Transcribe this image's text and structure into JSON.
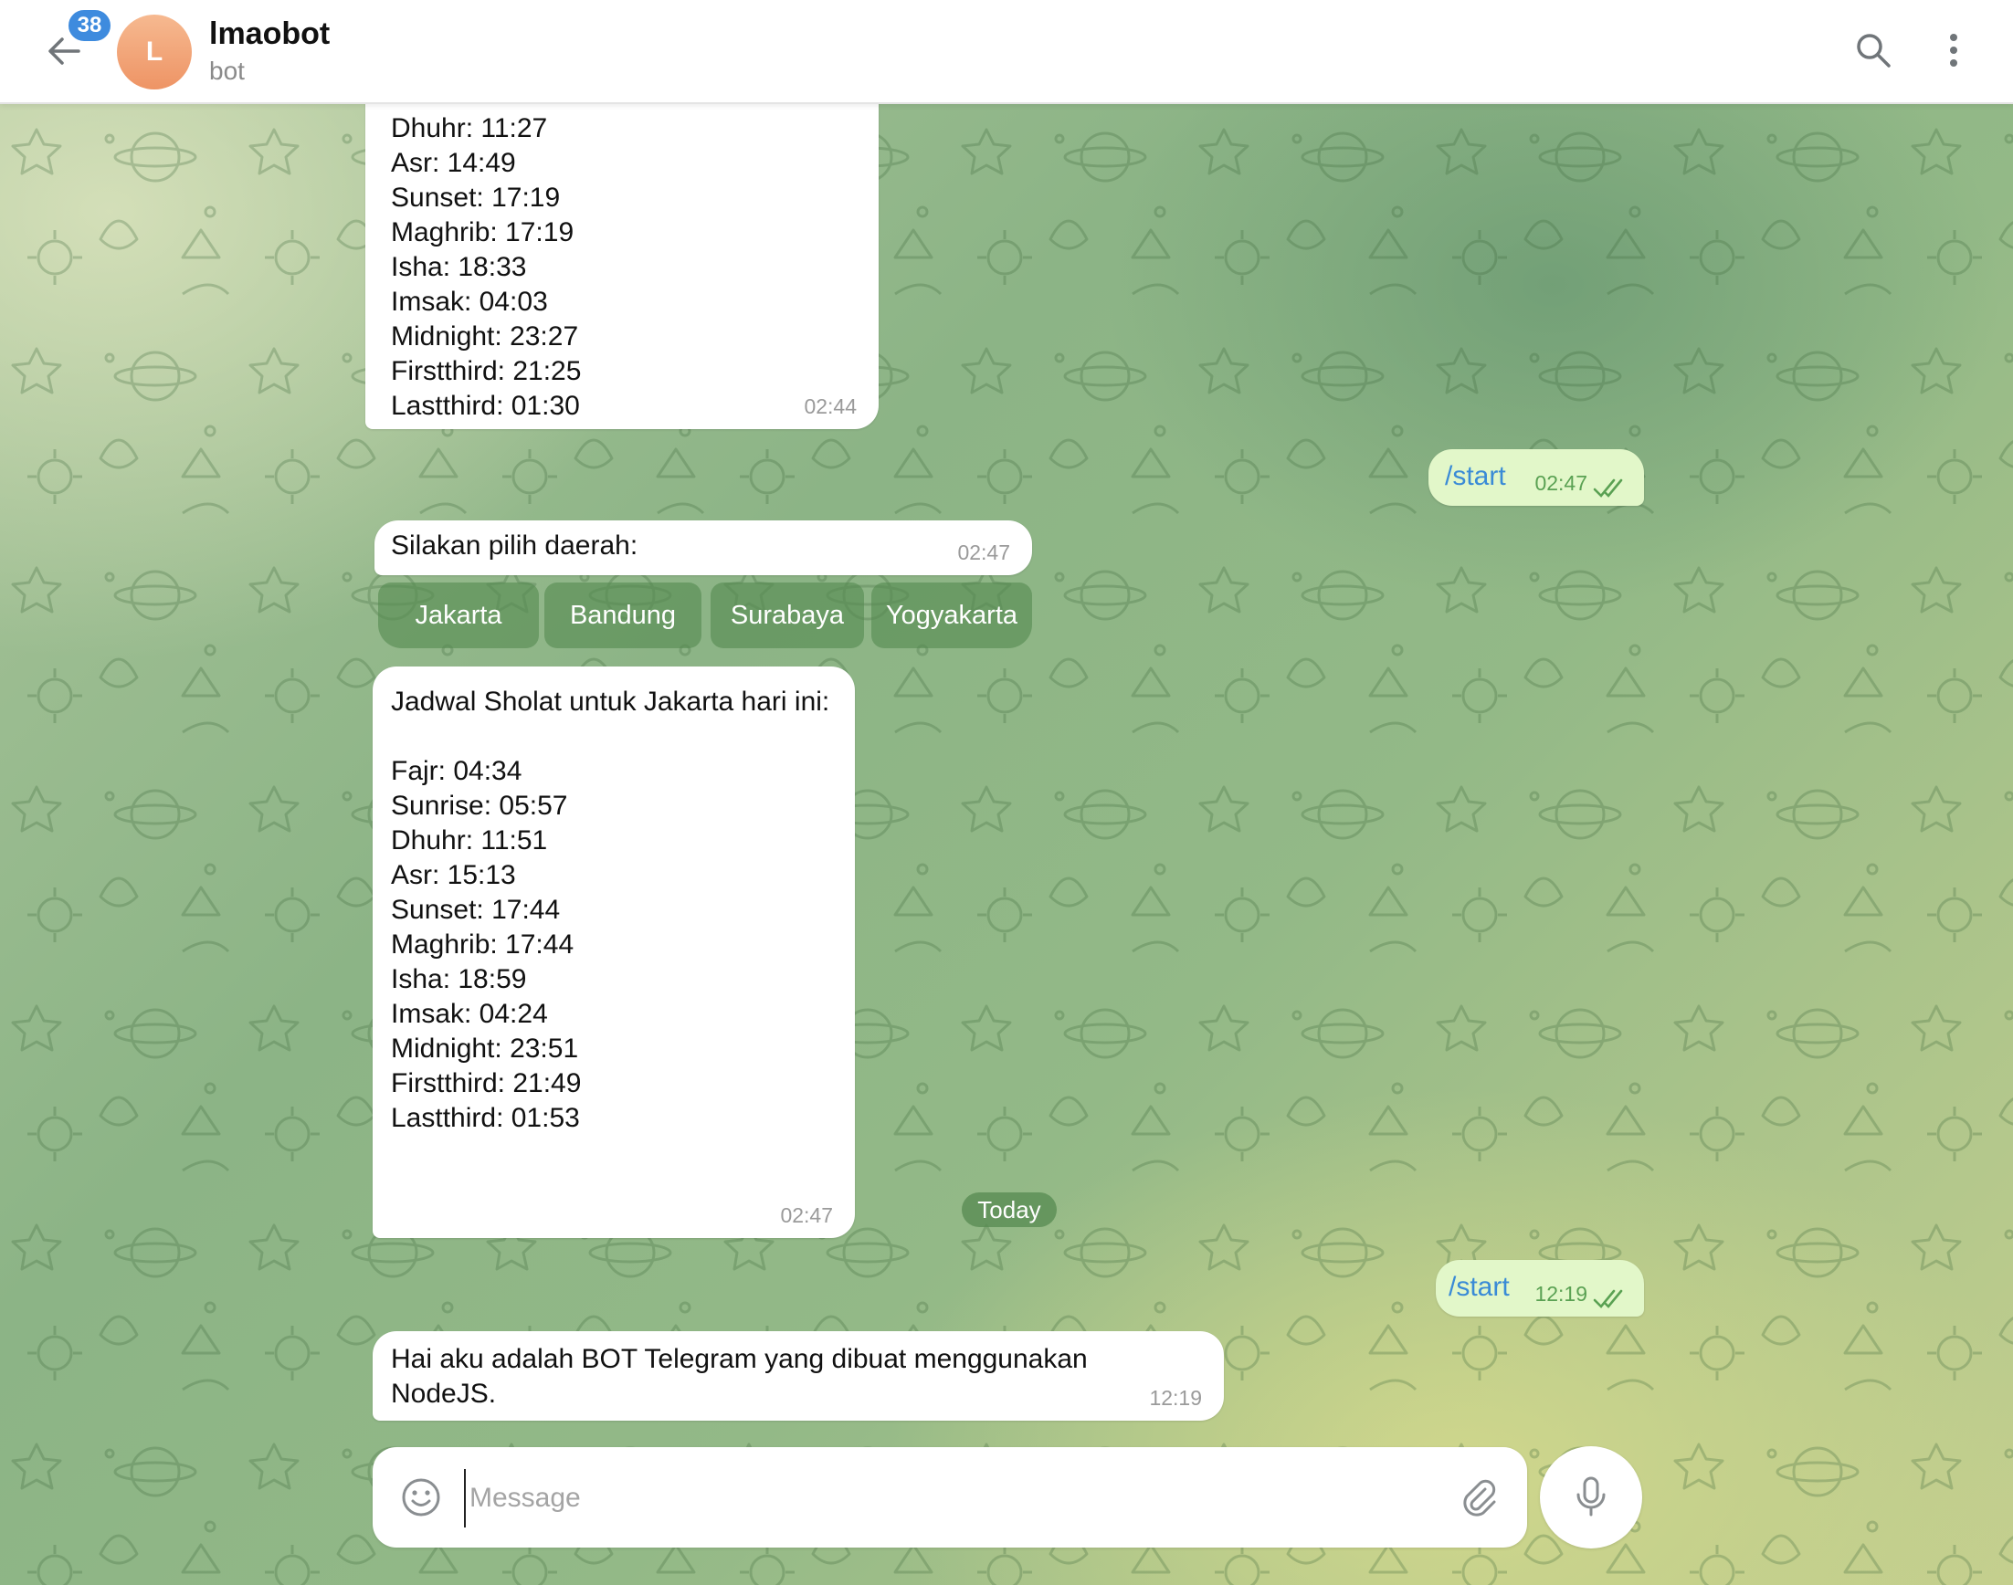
{
  "header": {
    "unread_count": "38",
    "avatar_letter": "L",
    "title": "lmaobot",
    "subtitle": "bot"
  },
  "messages": {
    "m1": {
      "lines": [
        "Dhuhr: 11:27",
        "Asr: 14:49",
        "Sunset: 17:19",
        "Maghrib: 17:19",
        "Isha: 18:33",
        "Imsak: 04:03",
        "Midnight: 23:27",
        "Firstthird: 21:25",
        "Lastthird: 01:30"
      ],
      "time": "02:44"
    },
    "m2": {
      "text": "/start",
      "time": "02:47"
    },
    "m3": {
      "text": "Silakan pilih daerah:",
      "time": "02:47"
    },
    "keyboard": [
      "Jakarta",
      "Bandung",
      "Surabaya",
      "Yogyakarta"
    ],
    "m4": {
      "lines": [
        "Jadwal Sholat untuk Jakarta hari ini:",
        "",
        "Fajr: 04:34",
        "Sunrise: 05:57",
        "Dhuhr: 11:51",
        "Asr: 15:13",
        "Sunset: 17:44",
        "Maghrib: 17:44",
        "Isha: 18:59",
        "Imsak: 04:24",
        "Midnight: 23:51",
        "Firstthird: 21:49",
        "Lastthird: 01:53"
      ],
      "time": "02:47"
    },
    "date_separator": "Today",
    "m5": {
      "text": "/start",
      "time": "12:19"
    },
    "m6": {
      "lines": [
        "Hai aku adalah BOT Telegram yang dibuat menggunakan",
        "NodeJS."
      ],
      "time": "12:19"
    }
  },
  "composer": {
    "placeholder": "Message"
  },
  "colors": {
    "header_bg": "#ffffff",
    "badge": "#3e8bde",
    "avatar": "#ee9465",
    "outgoing_bubble": "#e2f7c9",
    "outgoing_text": "#3a8bd6",
    "keyboard_button": "#568a50"
  },
  "icons": {
    "back": "arrow-left",
    "search": "magnifier",
    "menu": "vertical-dots",
    "emoji": "smiley",
    "attach": "paperclip",
    "mic": "microphone",
    "read_status": "double-check"
  }
}
